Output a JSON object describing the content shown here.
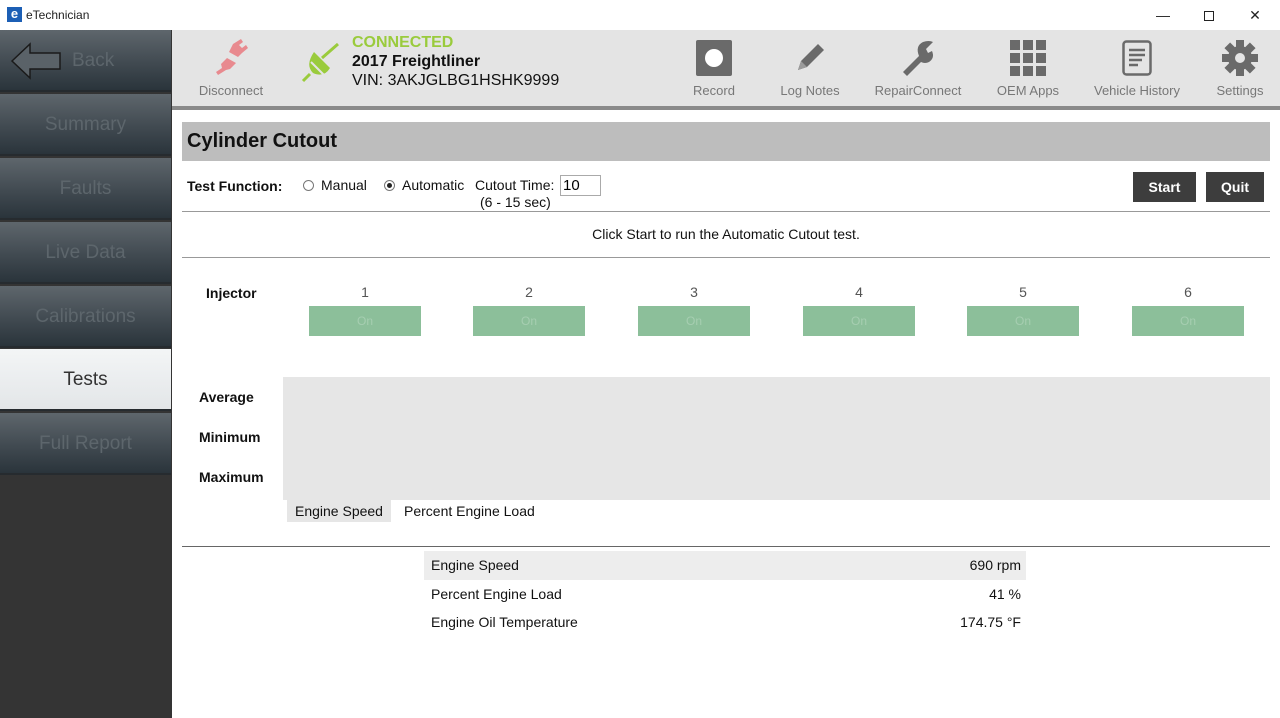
{
  "window": {
    "title": "eTechnician",
    "app_icon": "e",
    "controls": [
      "minimize",
      "maximize",
      "close"
    ]
  },
  "sidebar": {
    "back_label": "Back",
    "items": [
      {
        "label": "Summary",
        "active": false
      },
      {
        "label": "Faults",
        "active": false
      },
      {
        "label": "Live Data",
        "active": false
      },
      {
        "label": "Calibrations",
        "active": false
      },
      {
        "label": "Tests",
        "active": true
      },
      {
        "label": "Full Report",
        "active": false
      }
    ]
  },
  "toolbar": {
    "disconnect_label": "Disconnect",
    "connection_status": "CONNECTED",
    "vehicle_name": "2017 Freightliner",
    "vin": "VIN: 3AKJGLBG1HSHK9999",
    "tools": [
      {
        "label": "Record",
        "icon": "record-icon"
      },
      {
        "label": "Log Notes",
        "icon": "pencil-icon"
      },
      {
        "label": "RepairConnect",
        "icon": "wrench-icon"
      },
      {
        "label": "OEM Apps",
        "icon": "grid-icon"
      },
      {
        "label": "Vehicle History",
        "icon": "document-icon"
      },
      {
        "label": "Settings",
        "icon": "gear-icon"
      }
    ],
    "colors": {
      "connected": "#9acb3c",
      "disconnect": "#e88a8f"
    }
  },
  "test": {
    "title": "Cylinder Cutout",
    "test_function_label": "Test Function:",
    "modes": [
      {
        "label": "Manual",
        "selected": false
      },
      {
        "label": "Automatic",
        "selected": true
      }
    ],
    "cutout_time_label": "Cutout Time:",
    "cutout_time_value": "10",
    "cutout_range": "(6 - 15 sec)",
    "start_label": "Start",
    "quit_label": "Quit",
    "instruction": "Click Start to run the Automatic Cutout test.",
    "injector_label": "Injector",
    "injectors": [
      {
        "number": "1",
        "state": "On"
      },
      {
        "number": "2",
        "state": "On"
      },
      {
        "number": "3",
        "state": "On"
      },
      {
        "number": "4",
        "state": "On"
      },
      {
        "number": "5",
        "state": "On"
      },
      {
        "number": "6",
        "state": "On"
      }
    ],
    "stats": [
      "Average",
      "Minimum",
      "Maximum"
    ],
    "graph_tabs": [
      {
        "label": "Engine Speed",
        "active": true
      },
      {
        "label": "Percent Engine Load",
        "active": false
      }
    ]
  },
  "live_data": [
    {
      "name": "Engine Speed",
      "value": "690 rpm"
    },
    {
      "name": "Percent Engine Load",
      "value": "41 %"
    },
    {
      "name": "Engine Oil Temperature",
      "value": "174.75 °F"
    }
  ]
}
